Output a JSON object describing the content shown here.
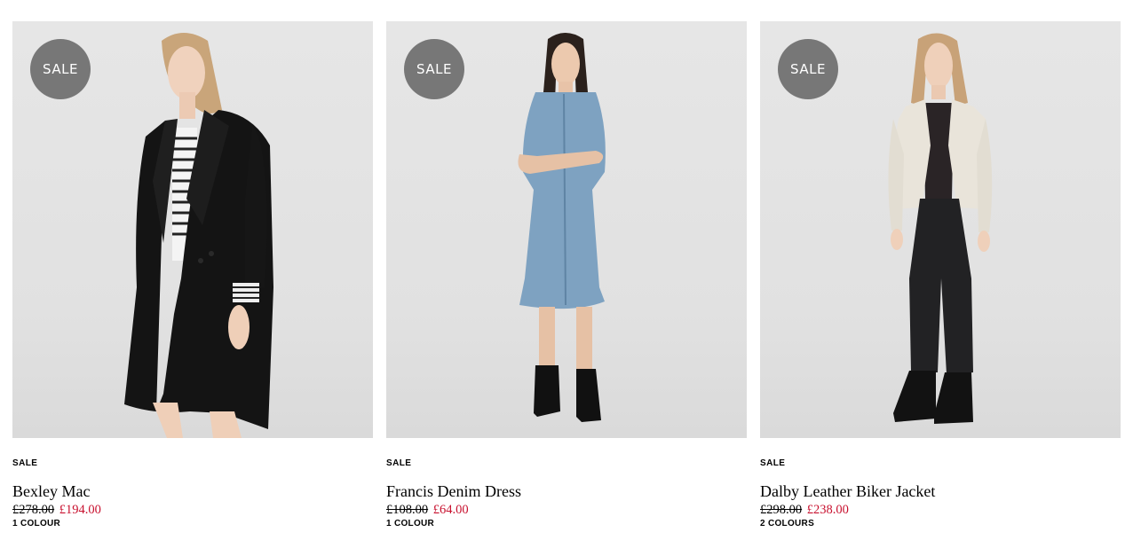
{
  "products": [
    {
      "badge": "SALE",
      "tag": "SALE",
      "name": "Bexley Mac",
      "was_price": "£278.00",
      "now_price": "£194.00",
      "colours": "1 COLOUR"
    },
    {
      "badge": "SALE",
      "tag": "SALE",
      "name": "Francis Denim Dress",
      "was_price": "£108.00",
      "now_price": "£64.00",
      "colours": "1 COLOUR"
    },
    {
      "badge": "SALE",
      "tag": "SALE",
      "name": "Dalby Leather Biker Jacket",
      "was_price": "£298.00",
      "now_price": "£238.00",
      "colours": "2 COLOURS"
    }
  ],
  "colors": {
    "badge_bg": "#777777",
    "sale_price": "#c8102e",
    "image_bg": "#e3e3e3"
  }
}
